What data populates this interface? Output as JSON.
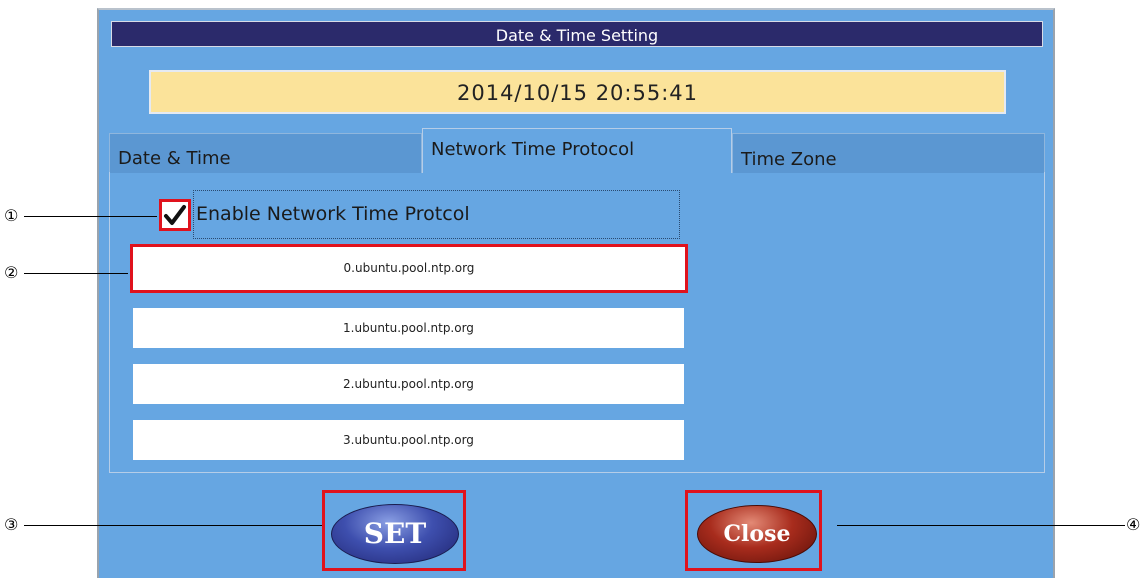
{
  "window": {
    "title": "Date & Time Setting"
  },
  "clock": {
    "value": "2014/10/15 20:55:41"
  },
  "tabs": [
    {
      "label": "Date & Time",
      "active": false
    },
    {
      "label": "Network Time Protocol",
      "active": true
    },
    {
      "label": "Time Zone",
      "active": false
    }
  ],
  "ntp": {
    "enable_label": "Enable Network Time Protcol",
    "enabled": true,
    "servers": [
      "0.ubuntu.pool.ntp.org",
      "1.ubuntu.pool.ntp.org",
      "2.ubuntu.pool.ntp.org",
      "3.ubuntu.pool.ntp.org"
    ]
  },
  "buttons": {
    "set_label": "SET",
    "close_label": "Close"
  },
  "callouts": [
    "①",
    "②",
    "③",
    "④"
  ],
  "colors": {
    "window_bg": "#66a6e2",
    "titlebar": "#2b2a6b",
    "clock_bg": "#fbe39a",
    "highlight": "#e0121d",
    "set_button": "#3e4fae",
    "close_button": "#a82c1d"
  },
  "icons": {
    "checkbox": "checkmark-icon"
  }
}
